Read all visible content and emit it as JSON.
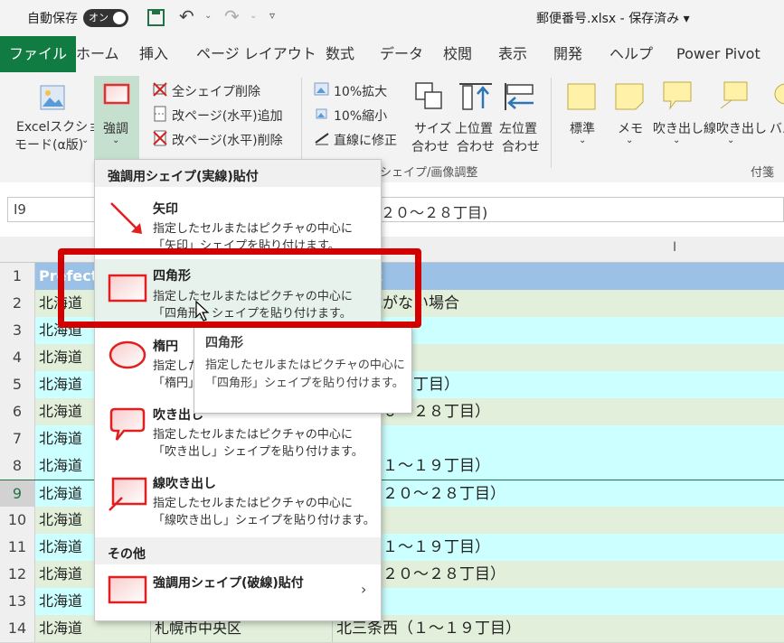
{
  "titlebar": {
    "autosave_label": "自動保存",
    "autosave_toggle": "オン",
    "filename": "郵便番号.xlsx",
    "separator": "-",
    "save_status": "保存済み"
  },
  "tabs": [
    "ファイル",
    "ホーム",
    "挿入",
    "ページ レイアウト",
    "数式",
    "データ",
    "校閲",
    "表示",
    "開発",
    "ヘルプ",
    "Power Pivot"
  ],
  "ribbon": {
    "excel_mode": [
      "Excelスクショ",
      "モード(α版)"
    ],
    "emphasis": "強調",
    "delete_all_shapes": "全シェイプ削除",
    "add_page_break": "改ページ(水平)追加",
    "delete_page_break": "改ページ(水平)削除",
    "zoom_in": "10%拡大",
    "zoom_out": "10%縮小",
    "fix_line": "直線に修正",
    "size_match": [
      "サイズ",
      "合わせ"
    ],
    "top_match": [
      "上位置",
      "合わせ"
    ],
    "left_match": [
      "左位置",
      "合わせ"
    ],
    "group_shape_adjust": "シェイプ/画像調整",
    "sticky_items": [
      "標準",
      "メモ",
      "吹き出し",
      "線吹き出し",
      "バル"
    ],
    "group_sticky": "付箋"
  },
  "formula_bar": {
    "name_box": "I9",
    "content": "２０～２８丁目)"
  },
  "grid": {
    "col_i_header": "I",
    "header_row_a": "Prefect",
    "header_row_c": "ress2",
    "rows": [
      {
        "num": "1",
        "a": "",
        "b": "",
        "c": ""
      },
      {
        "num": "2",
        "a": "北海道",
        "b": "",
        "c": "に掲載がない場合"
      },
      {
        "num": "3",
        "a": "北海道",
        "b": "",
        "c": ""
      },
      {
        "num": "4",
        "a": "北海道",
        "b": "",
        "c": ""
      },
      {
        "num": "5",
        "a": "北海道",
        "b": "",
        "c": "（１～１９丁目）"
      },
      {
        "num": "6",
        "a": "北海道",
        "b": "",
        "c": "西（２０～２８丁目）"
      },
      {
        "num": "7",
        "a": "北海道",
        "b": "",
        "c": "条東"
      },
      {
        "num": "8",
        "a": "北海道",
        "b": "",
        "c": "条西（１～１９丁目）"
      },
      {
        "num": "9",
        "a": "北海道",
        "b": "",
        "c": "条西（２０～２８丁目）"
      },
      {
        "num": "10",
        "a": "北海道",
        "b": "",
        "c": "条東"
      },
      {
        "num": "11",
        "a": "北海道",
        "b": "",
        "c": "条西（１～１９丁目）"
      },
      {
        "num": "12",
        "a": "北海道",
        "b": "",
        "c": "条西（２０～２８丁目）"
      },
      {
        "num": "13",
        "a": "北海道",
        "b": "",
        "c": "条東"
      },
      {
        "num": "14",
        "a": "北海道",
        "b": "札幌市中央区",
        "c": "北三条西（１～１９丁目）"
      }
    ]
  },
  "menu": {
    "section1": "強調用シェイプ(実線)貼付",
    "items": [
      {
        "title": "矢印",
        "desc1": "指定したセルまたはピクチャの中心に",
        "desc2": "「矢印」シェイプを貼り付けます。"
      },
      {
        "title": "四角形",
        "desc1": "指定したセルまたはピクチャの中心に",
        "desc2": "「四角形」シェイプを貼り付けます。"
      },
      {
        "title": "楕円",
        "desc1": "指定した",
        "desc2": "「楕円」"
      },
      {
        "title": "吹き出し",
        "desc1": "指定したセルまたはピクチャの中心に",
        "desc2": "「吹き出し」シェイプを貼り付けます。"
      },
      {
        "title": "線吹き出し",
        "desc1": "指定したセルまたはピクチャの中心に",
        "desc2": "「線吹き出し」シェイプを貼り付けます。"
      }
    ],
    "section2": "その他",
    "dashed_item": "強調用シェイプ(破線)貼付"
  },
  "tooltip": {
    "title": "四角形",
    "line1": "指定したセルまたはピクチャの中心に",
    "line2": "「四角形」シェイプを貼り付けます。"
  },
  "colors": {
    "excel_green": "#107c41",
    "highlight_red": "#d40000",
    "row_cyan": "#ccffff",
    "row_green": "#e2efda",
    "header_blue": "#9bc2e6"
  }
}
